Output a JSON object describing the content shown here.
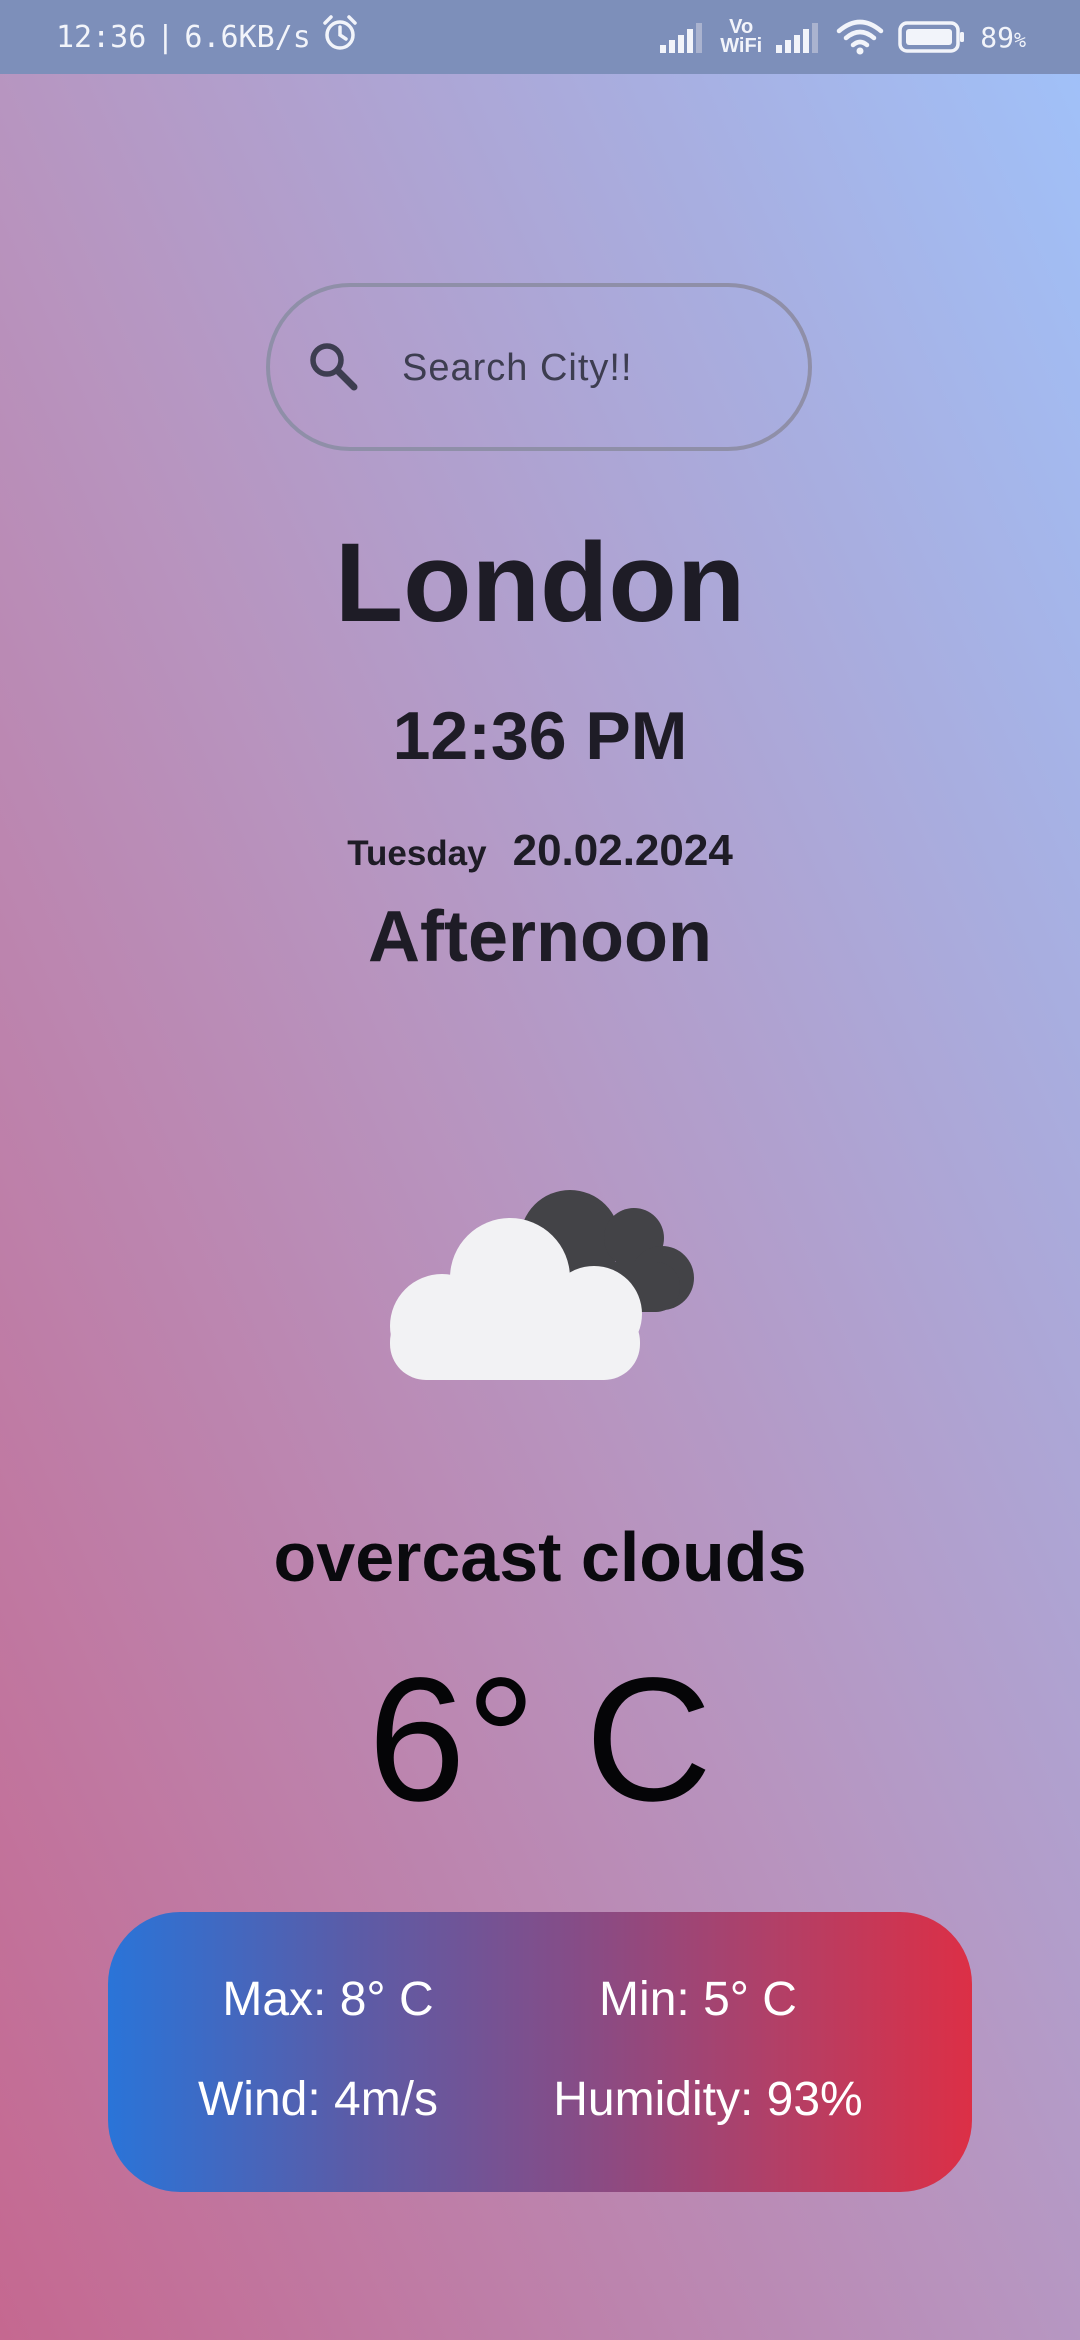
{
  "status_bar": {
    "time": "12:36",
    "separator": "|",
    "network_speed": "6.6KB/s",
    "vowifi_top": "Vo",
    "vowifi_bottom": "WiFi",
    "battery_value": "89",
    "battery_unit": "%",
    "icons": [
      "alarm-icon",
      "signal-icon",
      "vowifi-icon",
      "signal-icon",
      "wifi-icon",
      "battery-icon"
    ]
  },
  "search": {
    "placeholder": "Search City!!",
    "value": ""
  },
  "location": {
    "city": "London",
    "time": "12:36 PM",
    "weekday": "Tuesday",
    "date": "20.02.2024",
    "period": "Afternoon"
  },
  "weather": {
    "icon": "overcast-clouds-icon",
    "description": "overcast clouds",
    "temperature": "6° C"
  },
  "details": {
    "max": "Max: 8° C",
    "min": "Min: 5° C",
    "wind": "Wind: 4m/s",
    "humidity": "Humidity: 93%"
  },
  "colors": {
    "card_gradient_start": "#2a74d8",
    "card_gradient_end": "#dc2f46",
    "status_bar": "#7d8fba"
  }
}
